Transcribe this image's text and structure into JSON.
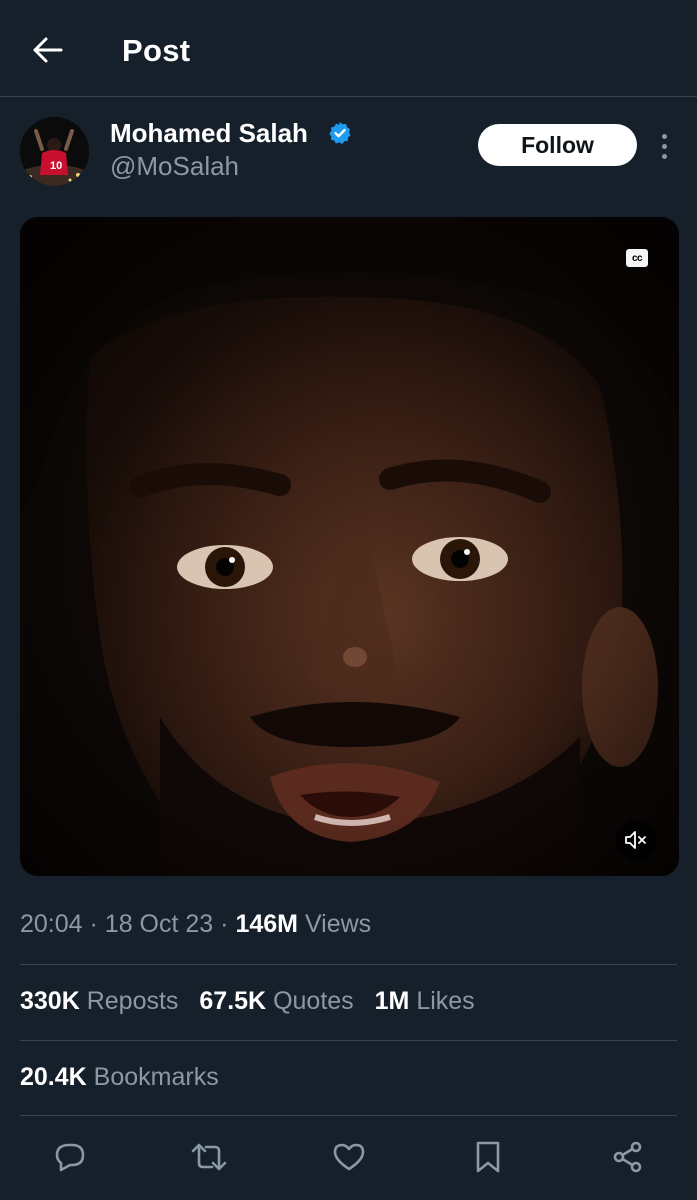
{
  "header": {
    "title": "Post",
    "back_icon": "arrow-left-icon"
  },
  "author": {
    "display_name": "Mohamed Salah",
    "handle": "@MoSalah",
    "verified": true,
    "verified_color": "#1d9bf0",
    "avatar_icon": "profile-photo",
    "follow_label": "Follow",
    "more_icon": "more-vertical-icon"
  },
  "media": {
    "type": "video",
    "cc_label": "cc",
    "muted": true,
    "mute_icon": "volume-muted-icon"
  },
  "meta": {
    "time": "20:04",
    "date": "18 Oct 23",
    "separator": "·",
    "views_count": "146M",
    "views_label": "Views"
  },
  "stats": {
    "reposts_count": "330K",
    "reposts_label": "Reposts",
    "quotes_count": "67.5K",
    "quotes_label": "Quotes",
    "likes_count": "1M",
    "likes_label": "Likes",
    "bookmarks_count": "20.4K",
    "bookmarks_label": "Bookmarks"
  },
  "actions": [
    "reply-icon",
    "repost-icon",
    "like-icon",
    "bookmark-icon",
    "share-icon"
  ],
  "colors": {
    "background": "#15202b",
    "divider": "#38444d",
    "secondary_text": "#8b98a5",
    "primary_text": "#ffffff"
  }
}
